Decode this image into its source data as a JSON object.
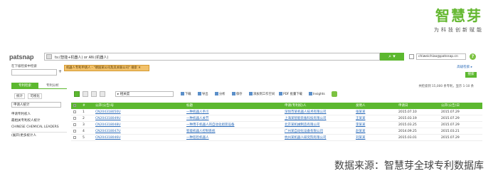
{
  "brand": {
    "name": "智慧芽",
    "slogan": "为科技创新赋能"
  },
  "app": {
    "logo": "patsnap",
    "search": {
      "value": "ts:(智能+机器人) or AN:(机器人)",
      "button_label": "⌕  ▾"
    },
    "account": "chiweichiao@patsnap.cn",
    "help": "?"
  },
  "query_row": {
    "label": "在下级检索中检索",
    "plus": "+",
    "query_chip": "机器人专利申请人 - \"德国某公司及其关联公司\" 搜索 ✕",
    "advanced_link": "高级检索  ▸",
    "go_button": "搜索"
  },
  "left_panel": {
    "tabs": [
      "专利检索",
      "专利分析"
    ],
    "sort": [
      "统计",
      "可视化"
    ],
    "select": "申请人统计",
    "items": [
      "申请专利权人",
      "最相关专利权人统计",
      "CHINESE CHEMICAL LEADERS",
      "(展开)更多统计人"
    ]
  },
  "main": {
    "results_count": "共检索到 15,000 条专利，显示 1-10 条",
    "sort_select": "▸ 相关度",
    "tools": [
      "下载",
      "导出",
      "分析",
      "保存",
      "添加到工作空间",
      "PDF 批量下载",
      "Insights"
    ],
    "headers": [
      "",
      "#",
      "公开(公告)号",
      "标题",
      "申请(专利权)人",
      "发明人",
      "申请日",
      "公开(公告)日"
    ],
    "rows": [
      [
        "",
        "1",
        "CN204318050U",
        "一种机器人手爪",
        "深圳市某机器人技术有限公司",
        "张某某",
        "2015.07.10",
        "2015.07.29"
      ],
      [
        "",
        "2",
        "CN204318049U",
        "一种机器人关节",
        "上海某智能装备科技有限公司",
        "王某某",
        "2015.03.19",
        "2015.07.29"
      ],
      [
        "",
        "3",
        "CN204318048U",
        "一种用于机器人的自动化组装设备",
        "北京某机械制造有限公司",
        "李某某",
        "2015.03.25",
        "2015.07.29"
      ],
      [
        "",
        "4",
        "CN204318047U",
        "智能机器人控制系统",
        "广州某自动化设备有限公司",
        "赵某某",
        "2014.09.25",
        "2015.03.21"
      ],
      [
        "",
        "5",
        "CN204318046U",
        "一种巡检机器人",
        "杭州某机器人研究院有限公司",
        "刘某某",
        "2015.03.01",
        "2015.07.29"
      ]
    ]
  },
  "footer": {
    "source": "数据来源：智慧芽全球专利数据库"
  }
}
